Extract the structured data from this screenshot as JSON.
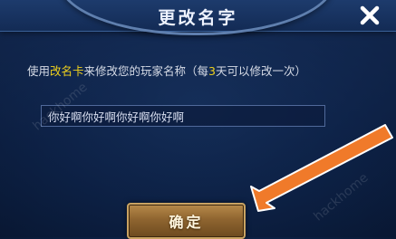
{
  "dialog": {
    "title": "更改名字",
    "close_icon": "close-x-icon"
  },
  "notice": {
    "part1": "使用",
    "card_name": "改名卡",
    "part2": "来修改您的玩家名称（每",
    "days": "3",
    "part3": "天可以修改一次）"
  },
  "name_input": {
    "value": "你好啊你好啊你好啊你好啊"
  },
  "confirm_button": {
    "label": "确定"
  },
  "annotation": {
    "arrow_color": "#f07a2a"
  },
  "watermarks": [
    "hackhome",
    "hackhome"
  ],
  "colors": {
    "highlight": "#f1d21c",
    "title_bar": "#1d3b6c",
    "button_gold": "#a57a3e"
  }
}
